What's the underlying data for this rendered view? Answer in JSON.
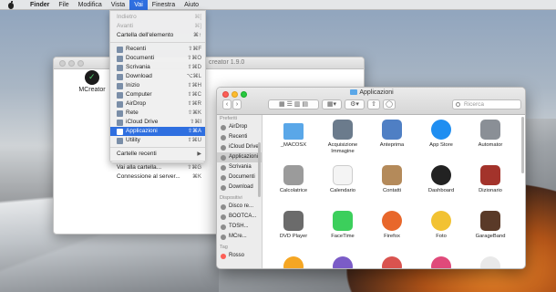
{
  "menubar": {
    "items": [
      {
        "label": "Finder",
        "bold": true
      },
      {
        "label": "File"
      },
      {
        "label": "Modifica"
      },
      {
        "label": "Vista"
      },
      {
        "label": "Vai",
        "active": true
      },
      {
        "label": "Finestra"
      },
      {
        "label": "Aiuto"
      }
    ]
  },
  "vai_menu": {
    "rows": [
      {
        "label": "Indietro",
        "shortcut": "⌘[",
        "disabled": true
      },
      {
        "label": "Avanti",
        "shortcut": "⌘]",
        "disabled": true
      },
      {
        "label": "Cartella dell'elemento",
        "shortcut": "⌘↑"
      },
      {
        "sep": true
      },
      {
        "label": "Recenti",
        "shortcut": "⇧⌘F",
        "icon": "clock-icon"
      },
      {
        "label": "Documenti",
        "shortcut": "⇧⌘O",
        "icon": "documents-icon"
      },
      {
        "label": "Scrivania",
        "shortcut": "⇧⌘D",
        "icon": "desktop-icon"
      },
      {
        "label": "Download",
        "shortcut": "⌥⌘L",
        "icon": "download-icon"
      },
      {
        "label": "Inizio",
        "shortcut": "⇧⌘H",
        "icon": "home-icon"
      },
      {
        "label": "Computer",
        "shortcut": "⇧⌘C",
        "icon": "computer-icon"
      },
      {
        "label": "AirDrop",
        "shortcut": "⇧⌘R",
        "icon": "airdrop-icon"
      },
      {
        "label": "Rete",
        "shortcut": "⇧⌘K",
        "icon": "network-icon"
      },
      {
        "label": "iCloud Drive",
        "shortcut": "⇧⌘I",
        "icon": "cloud-icon"
      },
      {
        "label": "Applicazioni",
        "shortcut": "⇧⌘A",
        "icon": "applications-icon",
        "highlight": true
      },
      {
        "label": "Utility",
        "shortcut": "⇧⌘U",
        "icon": "utility-icon"
      },
      {
        "sep": true
      },
      {
        "label": "Cartelle recenti",
        "shortcut": "▶"
      },
      {
        "sep": true
      },
      {
        "label": "Vai alla cartella...",
        "shortcut": "⇧⌘G"
      },
      {
        "label": "Connessione al server...",
        "shortcut": "⌘K"
      }
    ]
  },
  "mcreator_window": {
    "title": "creator 1.9.0",
    "app_label": "MCreator"
  },
  "finder": {
    "title": "Applicazioni",
    "search_placeholder": "Ricerca",
    "sidebar": {
      "sections": [
        {
          "heading": "Preferiti",
          "items": [
            "AirDrop",
            "Recenti",
            "iCloud Drive",
            "Applicazioni",
            "Scrivania",
            "Documenti",
            "Download"
          ]
        },
        {
          "heading": "Dispositivi",
          "items": [
            "Disco re...",
            "BOOTCA...",
            "TOSH...",
            "MCre..."
          ]
        },
        {
          "heading": "Tag",
          "items": [
            "Rosso"
          ]
        }
      ],
      "selected": "Applicazioni"
    },
    "apps": [
      {
        "name": "_MACOSX",
        "color": "#5aa7e8"
      },
      {
        "name": "Acquisizione Immagine",
        "color": "#6b7b8c"
      },
      {
        "name": "Anteprima",
        "color": "#4f7fc4"
      },
      {
        "name": "App Store",
        "color": "#1f8ef1"
      },
      {
        "name": "Automator",
        "color": "#8a8f96"
      },
      {
        "name": "Calcolatrice",
        "color": "#9b9b9b"
      },
      {
        "name": "Calendario",
        "color": "#f4f4f4"
      },
      {
        "name": "Contatti",
        "color": "#b48a5a"
      },
      {
        "name": "Dashboard",
        "color": "#222222"
      },
      {
        "name": "Dizionario",
        "color": "#a3332b"
      },
      {
        "name": "DVD Player",
        "color": "#6b6b6b"
      },
      {
        "name": "FaceTime",
        "color": "#3ccf5c"
      },
      {
        "name": "Firefox",
        "color": "#e8672b"
      },
      {
        "name": "Foto",
        "color": "#f2c232"
      },
      {
        "name": "GarageBand",
        "color": "#5a3a28"
      },
      {
        "name": "",
        "color": "#f5a623"
      },
      {
        "name": "",
        "color": "#7b5cc7"
      },
      {
        "name": "",
        "color": "#d9534f"
      },
      {
        "name": "",
        "color": "#e04a7a"
      },
      {
        "name": "",
        "color": "#e9e9e9"
      }
    ]
  }
}
